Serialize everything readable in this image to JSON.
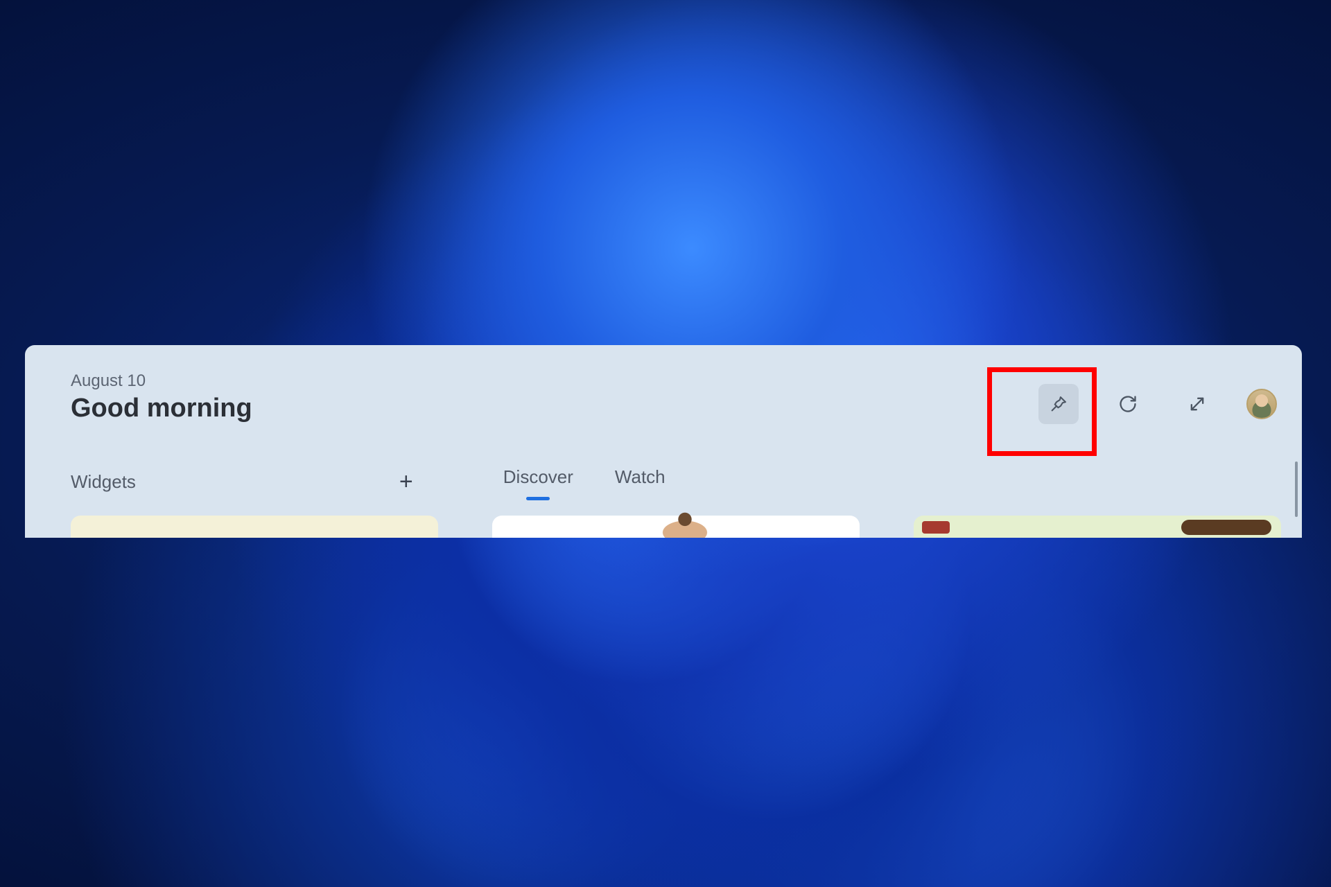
{
  "header": {
    "date": "August 10",
    "greeting": "Good morning"
  },
  "sections": {
    "widgets_label": "Widgets"
  },
  "tabs": {
    "discover": "Discover",
    "watch": "Watch"
  },
  "icons": {
    "pin": "pin-icon",
    "refresh": "refresh-icon",
    "expand": "expand-icon",
    "add": "plus-icon",
    "avatar": "user-avatar"
  },
  "colors": {
    "panel_bg": "#d9e4ef",
    "accent": "#1f6fe0",
    "highlight": "#ff0000"
  },
  "highlight_target": "pin-button"
}
